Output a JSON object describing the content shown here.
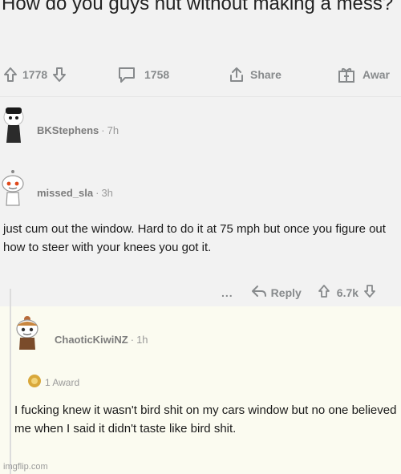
{
  "post": {
    "title": "How do you guys nut without making a mess?",
    "upvotes": "1778",
    "comments": "1758",
    "share_label": "Share",
    "award_label": "Awar"
  },
  "comments": [
    {
      "username": "BKStephens",
      "time": "7h"
    },
    {
      "username": "missed_sla",
      "time": "3h",
      "body": "just cum out the window. Hard to do it at 75 mph but once you figure out how to steer with your knees you got it.",
      "more": "...",
      "reply_label": "Reply",
      "votes": "6.7k"
    },
    {
      "username": "ChaoticKiwiNZ",
      "time": "1h",
      "award_text": "1 Award",
      "body": "I fucking knew it wasn't bird shit on my cars window but no one believed me when I said it didn't taste like bird shit."
    }
  ],
  "watermark": "imgflip.com",
  "colors": {
    "background": "#f2f2f2",
    "reply_background": "#fbfbf0",
    "meta_gray": "#878a8c"
  }
}
